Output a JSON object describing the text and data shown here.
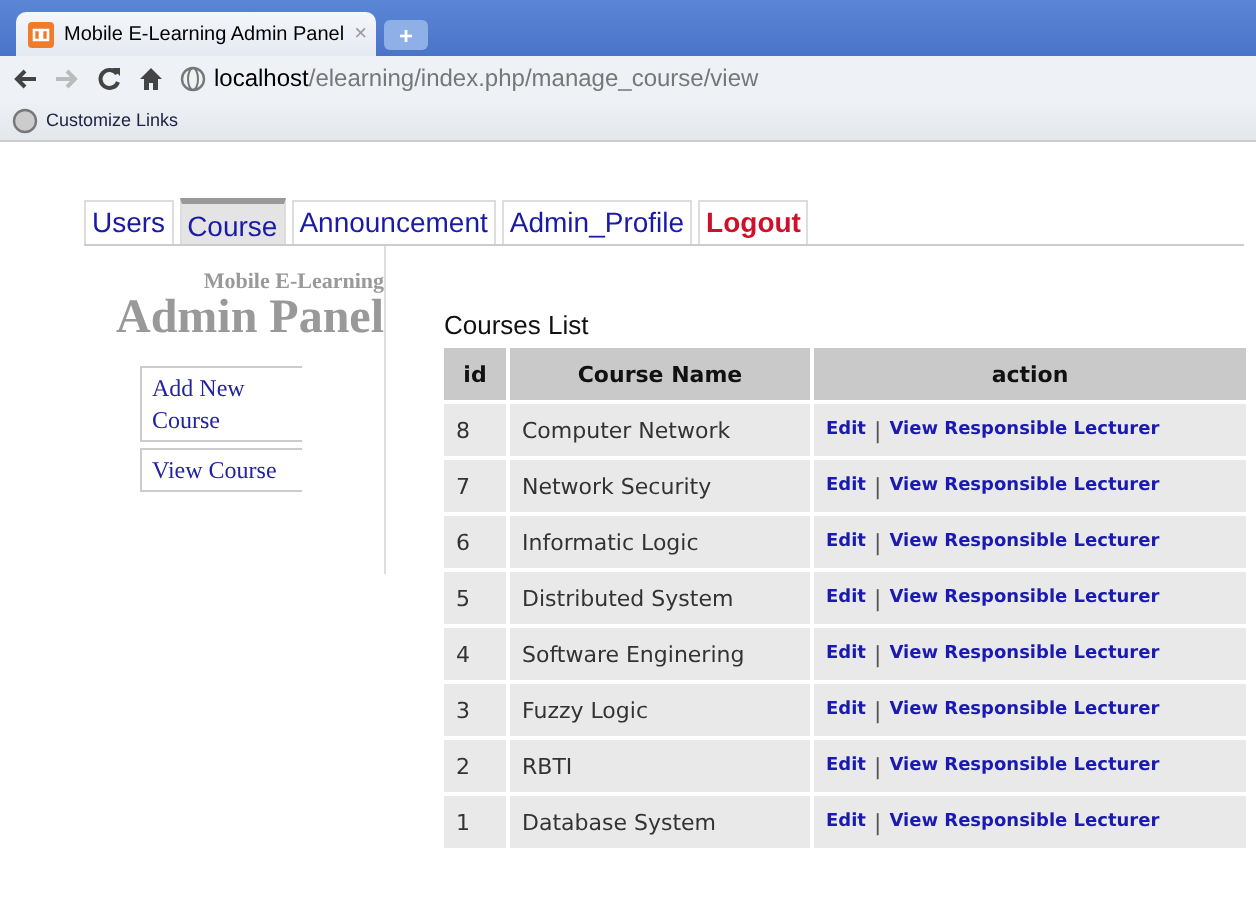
{
  "browser": {
    "tab_title": "Mobile E-Learning Admin Panel",
    "tab_close": "×",
    "new_tab": "+",
    "url_host": "localhost",
    "url_path": "/elearning/index.php/manage_course/view",
    "bookmark": "Customize Links"
  },
  "nav_tabs": [
    {
      "label": "Users",
      "selected": false,
      "kind": "normal"
    },
    {
      "label": "Course",
      "selected": true,
      "kind": "normal"
    },
    {
      "label": "Announcement",
      "selected": false,
      "kind": "normal"
    },
    {
      "label": "Admin_Profile",
      "selected": false,
      "kind": "normal"
    },
    {
      "label": "Logout",
      "selected": false,
      "kind": "logout"
    }
  ],
  "sidebar": {
    "subtitle": "Mobile E-Learning",
    "title": "Admin Panel",
    "items": [
      "Add New Course",
      "View Course"
    ]
  },
  "table": {
    "title": "Courses List",
    "columns": [
      "id",
      "Course Name",
      "action"
    ],
    "rows": [
      {
        "id": "8",
        "name": "Computer Network",
        "edit": "Edit",
        "separator": "|",
        "view": "View Responsible Lecturer"
      },
      {
        "id": "7",
        "name": "Network Security",
        "edit": "Edit",
        "separator": "|",
        "view": "View Responsible Lecturer"
      },
      {
        "id": "6",
        "name": "Informatic Logic",
        "edit": "Edit",
        "separator": "|",
        "view": "View Responsible Lecturer"
      },
      {
        "id": "5",
        "name": "Distributed System",
        "edit": "Edit",
        "separator": "|",
        "view": "View Responsible Lecturer"
      },
      {
        "id": "4",
        "name": "Software Enginering",
        "edit": "Edit",
        "separator": "|",
        "view": "View Responsible Lecturer"
      },
      {
        "id": "3",
        "name": "Fuzzy Logic",
        "edit": "Edit",
        "separator": "|",
        "view": "View Responsible Lecturer"
      },
      {
        "id": "2",
        "name": "RBTI",
        "edit": "Edit",
        "separator": "|",
        "view": "View Responsible Lecturer"
      },
      {
        "id": "1",
        "name": "Database System",
        "edit": "Edit",
        "separator": "|",
        "view": "View Responsible Lecturer"
      }
    ]
  }
}
